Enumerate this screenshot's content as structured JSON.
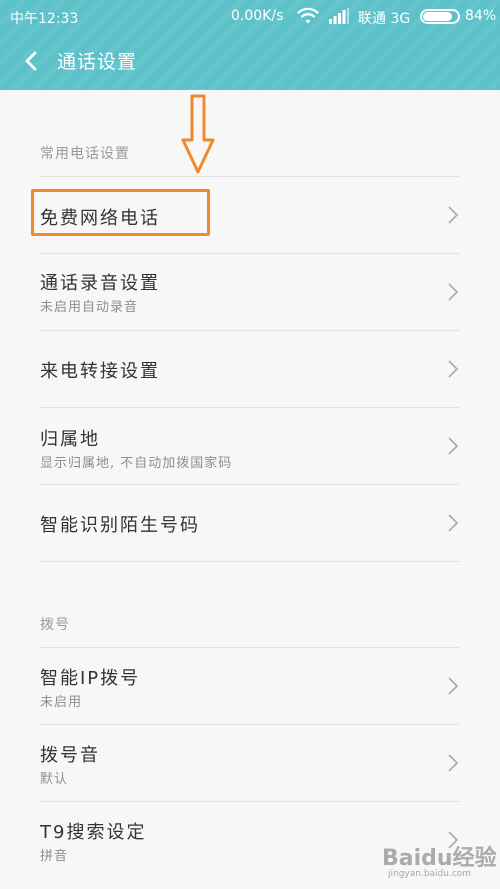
{
  "status_bar": {
    "time": "中午12:33",
    "network_speed": "0.00K/s",
    "carrier": "联通 3G",
    "battery_percent": "84%",
    "battery_level": 0.84,
    "wifi_icon": "wifi-icon",
    "signal_icon": "signal-icon"
  },
  "header": {
    "back_icon": "back-arrow-icon",
    "title": "通话设置",
    "background_color": "#5cc1c9"
  },
  "sections": [
    {
      "label": "常用电话设置",
      "items": [
        {
          "title": "免费网络电话",
          "subtitle": ""
        },
        {
          "title": "通话录音设置",
          "subtitle": "未启用自动录音"
        },
        {
          "title": "来电转接设置",
          "subtitle": ""
        },
        {
          "title": "归属地",
          "subtitle": "显示归属地, 不自动加拨国家码"
        },
        {
          "title": "智能识别陌生号码",
          "subtitle": ""
        }
      ]
    },
    {
      "label": "拨号",
      "items": [
        {
          "title": "智能IP拨号",
          "subtitle": "未启用"
        },
        {
          "title": "拨号音",
          "subtitle": "默认"
        },
        {
          "title": "T9搜索设定",
          "subtitle": "拼音"
        }
      ]
    }
  ],
  "annotation": {
    "highlight_color": "#f08a2c",
    "arrow_icon": "down-arrow-annotation-icon"
  },
  "watermark": {
    "text": "Baidu经验",
    "url": "jingyan.baidu.com"
  }
}
